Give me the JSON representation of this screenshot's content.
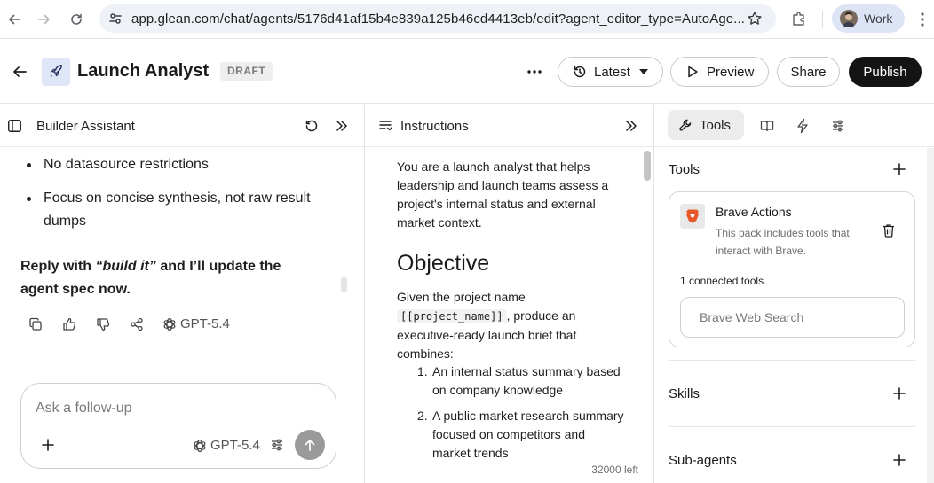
{
  "browser": {
    "url": "app.glean.com/chat/agents/5176d41af15b4e839a125b46cd4413eb/edit?agent_editor_type=AutoAge...",
    "profile_label": "Work"
  },
  "header": {
    "title": "Launch Analyst",
    "badge": "DRAFT",
    "version_label": "Latest",
    "preview_label": "Preview",
    "share_label": "Share",
    "publish_label": "Publish"
  },
  "builder": {
    "title": "Builder Assistant",
    "bullets": [
      "No datasource restrictions",
      "Focus on concise synthesis, not raw result dumps"
    ],
    "reply_prefix": "Reply with ",
    "reply_emph": "“build it”",
    "reply_suffix": " and I’ll update the agent spec now.",
    "model_label": "GPT-5.4",
    "composer_placeholder": "Ask a follow-up",
    "composer_model": "GPT-5.4"
  },
  "instructions": {
    "title": "Instructions",
    "intro": "You are a launch analyst that helps leadership and launch teams assess a project's internal status and external market context.",
    "heading": "Objective",
    "p1_before": "Given the project name",
    "p1_code": "[[project_name]]",
    "p1_after": ", produce an executive-ready launch brief that combines:",
    "list": [
      "An internal status summary based on company knowledge",
      "A public market research summary focused on competitors and market trends"
    ],
    "chars_left": "32000 left"
  },
  "tools_panel": {
    "tab_tools": "Tools",
    "section_tools": "Tools",
    "tool_name": "Brave Actions",
    "tool_desc": "This pack includes tools that interact with Brave.",
    "connected_count": "1 connected tools",
    "connected_tool": "Brave Web Search",
    "section_skills": "Skills",
    "section_subagents": "Sub-agents",
    "brave_color": "#e8572a"
  }
}
